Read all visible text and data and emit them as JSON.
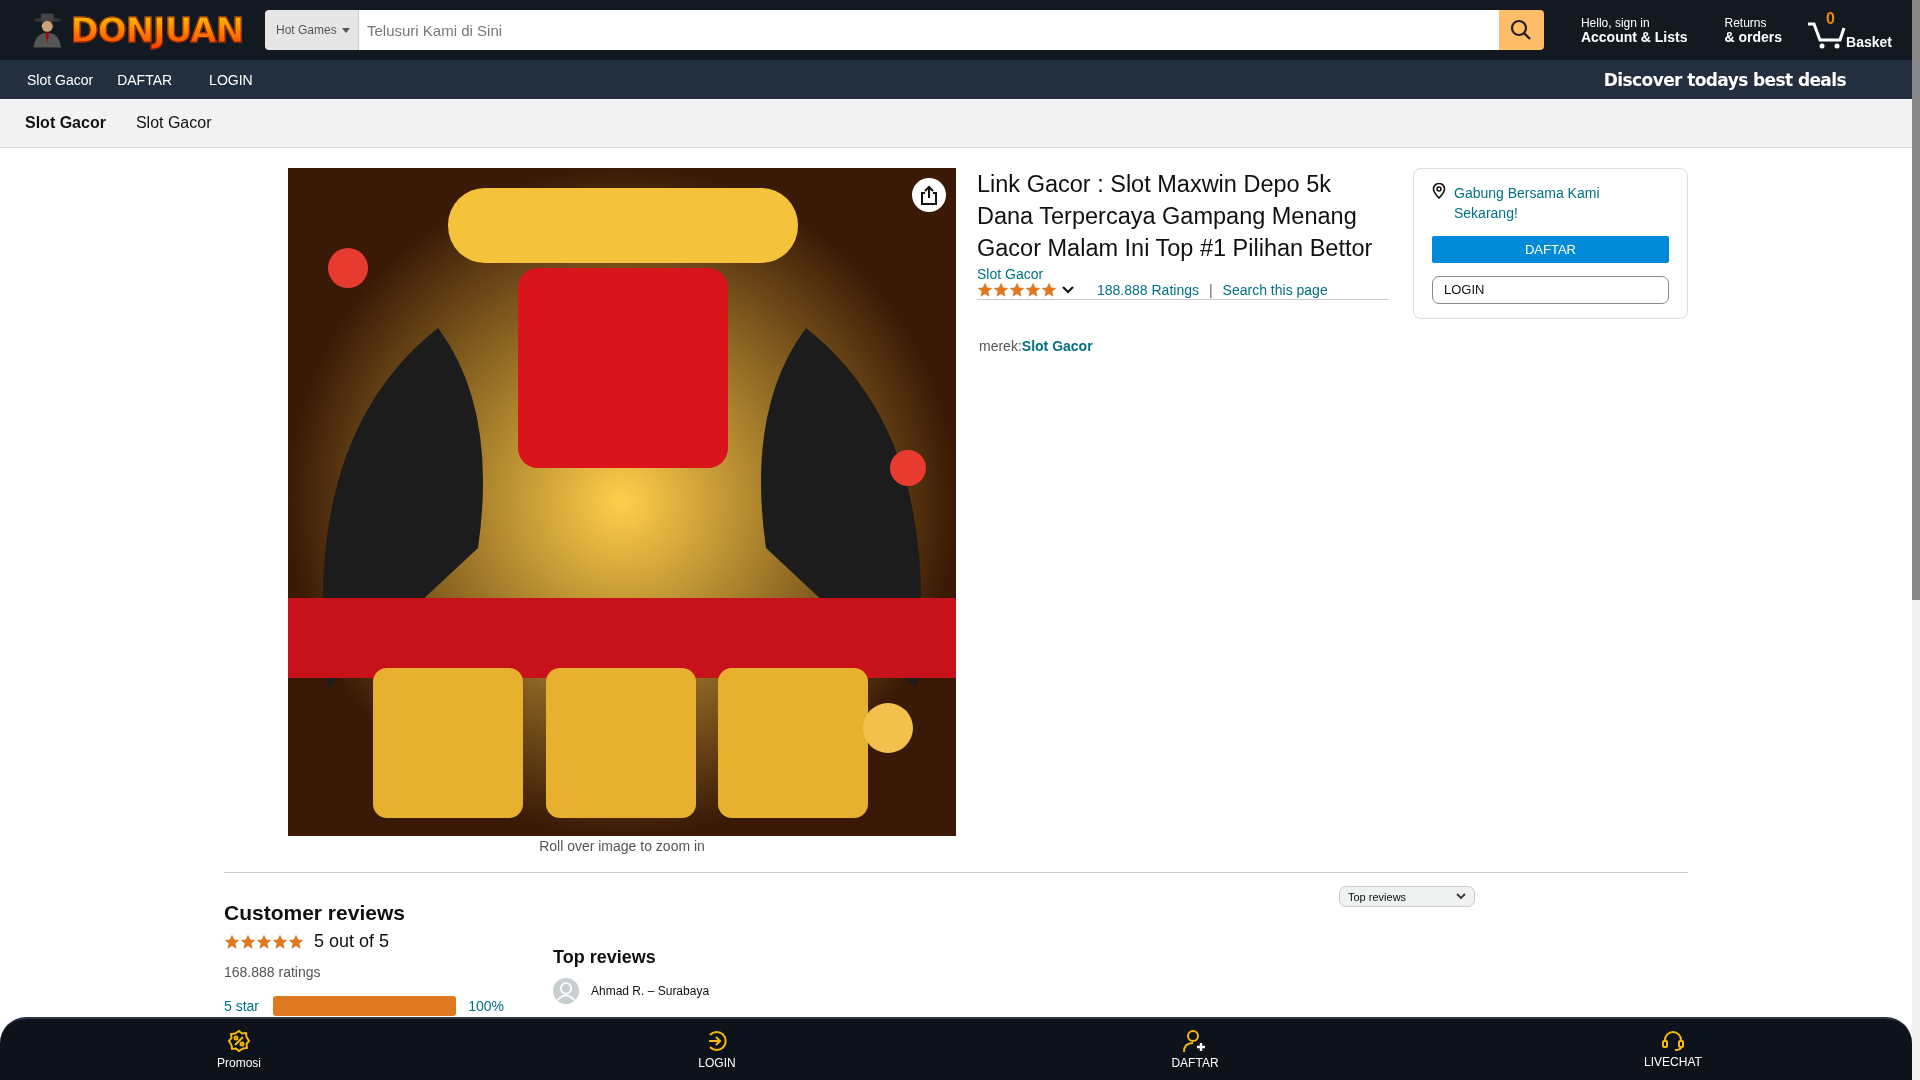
{
  "header": {
    "logo": "DONJUAN",
    "search": {
      "category": "Hot Games",
      "placeholder": "Telusuri Kami di Sini"
    },
    "account": {
      "greeting": "Hello, sign in",
      "label": "Account & Lists"
    },
    "orders": {
      "line1": "Returns",
      "line2": "& orders"
    },
    "basket": {
      "count": "0",
      "label": "Basket"
    }
  },
  "nav": {
    "links": [
      "Slot Gacor",
      "DAFTAR",
      "LOGIN"
    ],
    "promo": "Discover todays best deals"
  },
  "subnav": [
    {
      "label": "Slot Gacor",
      "selected": true
    },
    {
      "label": "Slot Gacor",
      "selected": false
    }
  ],
  "product": {
    "caption": "Roll over image to zoom in",
    "title": "Link Gacor : Slot Maxwin Depo 5k Dana Terpercaya Gampang Menang Gacor Malam Ini Top #1 Pilihan Bettor",
    "store": "Slot Gacor",
    "stars": 5,
    "ratings": "188.888 Ratings",
    "separator": "|",
    "search_link": "Search this page",
    "brand_label": "merek:",
    "brand": "Slot Gacor"
  },
  "buy_box": {
    "location": "Gabung Bersama Kami Sekarang!",
    "buttons": [
      {
        "label": "DAFTAR",
        "kind": "primary"
      },
      {
        "label": "LOGIN",
        "kind": "secondary"
      }
    ]
  },
  "reviews": {
    "title": "Customer reviews",
    "stars": 5,
    "summary": "5 out of 5",
    "count": "168.888 ratings",
    "histogram": [
      {
        "label": "5 star",
        "level": 1,
        "percent": "100%"
      }
    ],
    "sort": "Top reviews",
    "top_title": "Top reviews",
    "first_review": {
      "author": "Ahmad R. – Surabaya"
    }
  },
  "bottom_bar": [
    {
      "label": "Promosi",
      "kind": "promo"
    },
    {
      "label": "LOGIN",
      "kind": "login"
    },
    {
      "label": "DAFTAR",
      "kind": "register"
    },
    {
      "label": "LIVECHAT",
      "kind": "chat"
    }
  ]
}
